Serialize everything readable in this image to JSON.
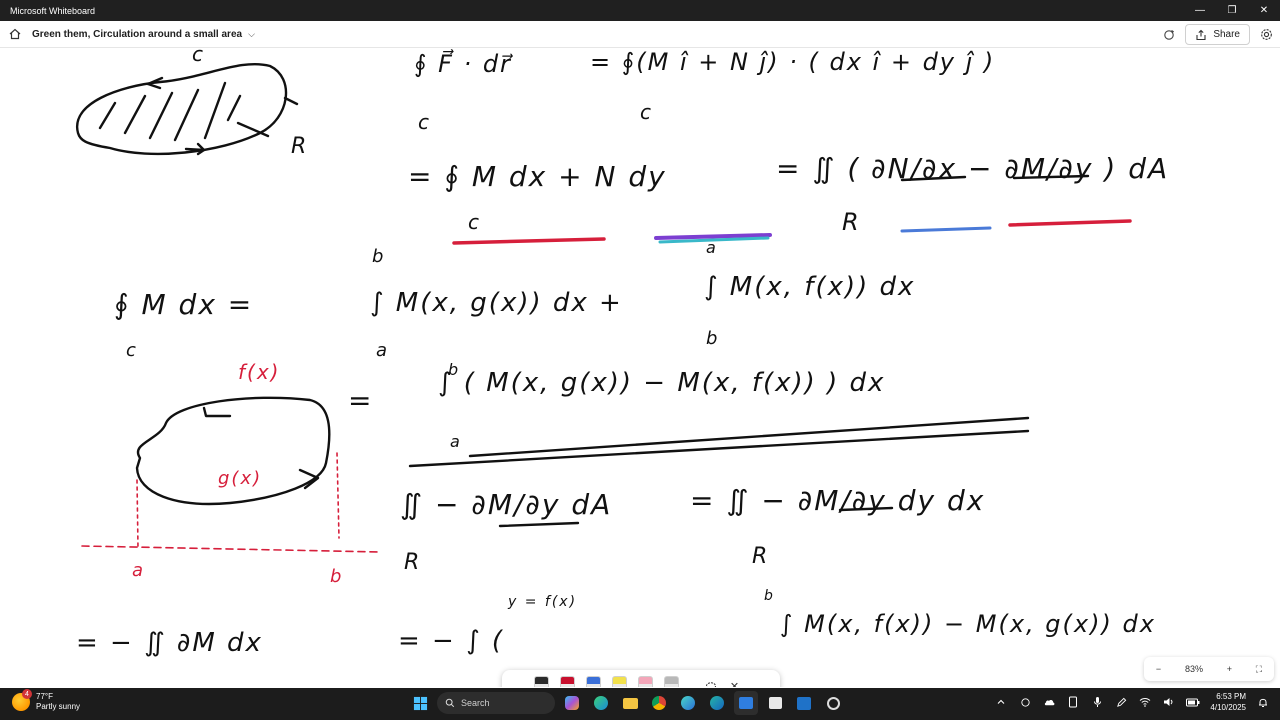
{
  "window": {
    "app_title": "Microsoft Whiteboard",
    "minimize_glyph": "—",
    "restore_glyph": "❐",
    "close_glyph": "✕"
  },
  "header": {
    "board_title": "Green them, Circulation around a small area",
    "chevron": "⌵",
    "share_label": "Share"
  },
  "whiteboard": {
    "line1": {
      "lhs": "∮ F⃗ · dr⃗",
      "rhs": "= ∮(M î + N ĵ) · ( dx î + dy ĵ )",
      "c1": "c",
      "c2": "c"
    },
    "line2": {
      "lhs": "= ∮ M dx + N dy",
      "rhs": "= ∬ ( ∂N/∂x − ∂M/∂y ) dA",
      "sub_c": "c",
      "sub_r": "R",
      "a_label": "a"
    },
    "line3": {
      "lhs": "∮ M dx =",
      "int1": "∫ M(x, g(x)) dx +",
      "int2": "∫ M(x, f(x)) dx",
      "b_top": "b",
      "a_bot": "a",
      "a_top": "a",
      "b_bot": "b",
      "c_sub": "c"
    },
    "line4": {
      "eq": "=",
      "integral": "∫ ( M(x, g(x)) − M(x, f(x)) ) dx",
      "b_top": "b",
      "a_bot": "a"
    },
    "line5": {
      "lhs": "∬ − ∂M/∂y dA",
      "rhs": "= ∬ − ∂M/∂y dy dx",
      "r1": "R",
      "r2": "R"
    },
    "line6": {
      "lhs": "= − ∬ ∂M dx",
      "mid": "= − ∫ (",
      "upper": "y = f(x)",
      "rhs": "∫ M(x, f(x)) − M(x, g(x)) dx",
      "b_top": "b"
    },
    "region1": {
      "c_top": "c",
      "r_label": "R"
    },
    "region2": {
      "f_label": "f(x)",
      "g_label": "g(x)",
      "a_axis": "a",
      "b_axis": "b"
    }
  },
  "ink_toolbar": {
    "pens": [
      {
        "name": "black-pen",
        "color": "#2b2b2b"
      },
      {
        "name": "red-pen",
        "color": "#c8102e"
      },
      {
        "name": "blue-pen",
        "color": "#3a6fd8"
      },
      {
        "name": "yellow-highlighter",
        "color": "#f2e14c"
      },
      {
        "name": "pink-highlighter",
        "color": "#f3a6b9"
      },
      {
        "name": "tape-tool",
        "color": "#b8b8b8"
      }
    ],
    "close_glyph": "✕"
  },
  "zoom": {
    "out_glyph": "−",
    "level": "83%",
    "in_glyph": "+",
    "fit_glyph": "⛶"
  },
  "taskbar": {
    "weather_temp": "77°F",
    "weather_desc": "Partly sunny",
    "weather_badge": "4",
    "search_placeholder": "Search",
    "time": "6:53 PM",
    "date": "4/10/2025"
  },
  "colors": {
    "ink": "#111111",
    "red_ink": "#d61f3b",
    "titlebar": "#202020",
    "taskbar": "#1c1c1c"
  }
}
